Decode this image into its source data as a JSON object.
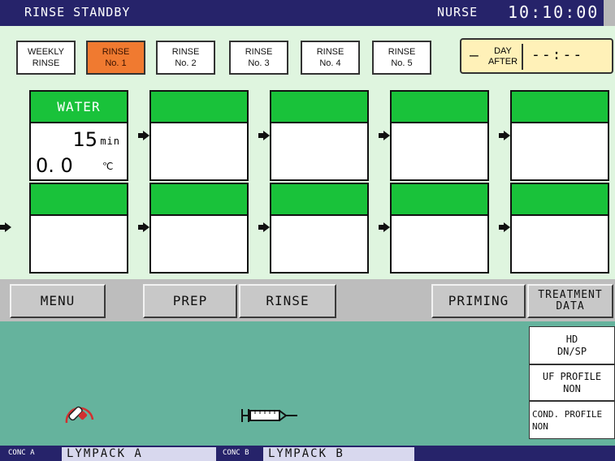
{
  "header": {
    "mode": "RINSE STANDBY",
    "user": "NURSE",
    "time": "10:10:00"
  },
  "tabs": [
    {
      "line1": "WEEKLY",
      "line2": "RINSE",
      "active": false
    },
    {
      "line1": "RINSE",
      "line2": "No. 1",
      "active": true
    },
    {
      "line1": "RINSE",
      "line2": "No. 2",
      "active": false
    },
    {
      "line1": "RINSE",
      "line2": "No. 3",
      "active": false
    },
    {
      "line1": "RINSE",
      "line2": "No. 4",
      "active": false
    },
    {
      "line1": "RINSE",
      "line2": "No. 5",
      "active": false
    }
  ],
  "schedule": {
    "dash": "—",
    "day_line1": "DAY",
    "day_line2": "AFTER",
    "time": "--:--"
  },
  "steps": {
    "s1": {
      "name": "WATER",
      "duration": "15",
      "duration_unit": "min",
      "temp": "0. 0",
      "temp_unit": "℃"
    }
  },
  "menu": {
    "menu": "MENU",
    "prep": "PREP",
    "rinse": "RINSE",
    "priming": "PRIMING",
    "treatment_line1": "TREATMENT",
    "treatment_line2": "DATA"
  },
  "side_panel": {
    "hd_line1": "HD",
    "hd_line2": "DN/SP",
    "uf_line1": "UF PROFILE",
    "uf_line2": "NON",
    "cond_line1": "COND. PROFILE",
    "cond_line2": "NON"
  },
  "footer": {
    "conc_a_label": "CONC A",
    "conc_a_value": "LYMPACK A",
    "conc_b_label": "CONC B",
    "conc_b_value": "LYMPACK B"
  },
  "colors": {
    "header_bg": "#26236a",
    "active_tab": "#f07a30",
    "step_header": "#19c23a",
    "teal": "#65b39d"
  }
}
